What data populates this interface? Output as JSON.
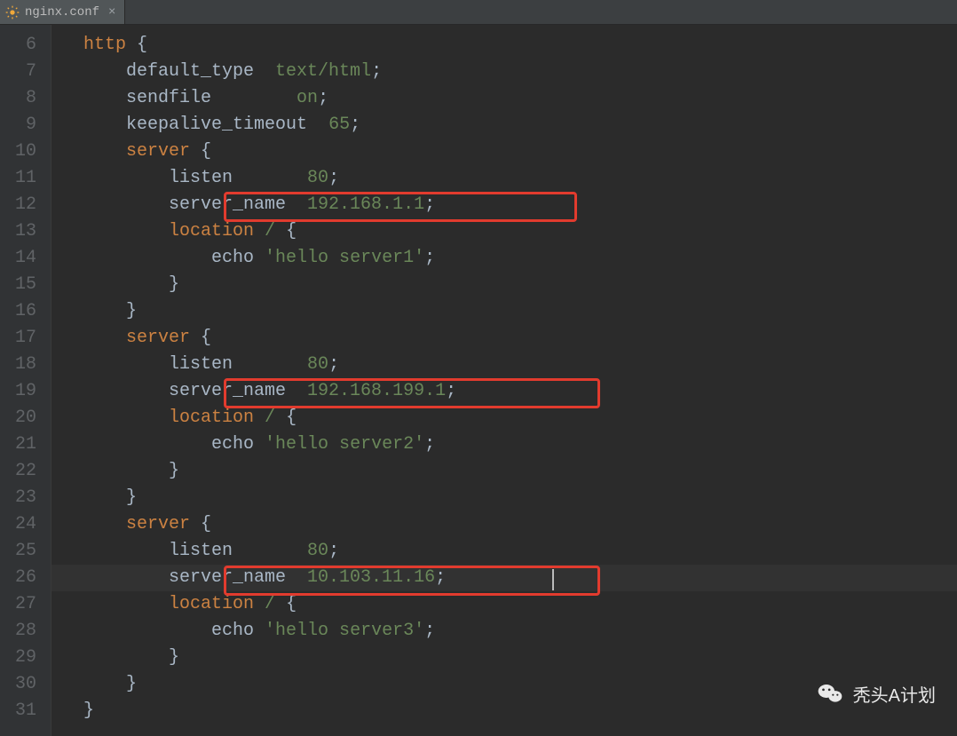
{
  "tab": {
    "filename": "nginx.conf",
    "close_glyph": "×"
  },
  "gutter": {
    "start": 6,
    "end": 31
  },
  "code": {
    "lines": [
      {
        "n": 6,
        "indent": 0,
        "tokens": [
          [
            "kw",
            "http"
          ],
          [
            "punc",
            " {"
          ]
        ]
      },
      {
        "n": 7,
        "indent": 1,
        "tokens": [
          [
            "dir",
            "default_type  "
          ],
          [
            "val",
            "text/html"
          ],
          [
            "punc",
            ";"
          ]
        ]
      },
      {
        "n": 8,
        "indent": 1,
        "tokens": [
          [
            "dir",
            "sendfile        "
          ],
          [
            "val",
            "on"
          ],
          [
            "punc",
            ";"
          ]
        ]
      },
      {
        "n": 9,
        "indent": 1,
        "tokens": [
          [
            "dir",
            "keepalive_timeout  "
          ],
          [
            "val",
            "65"
          ],
          [
            "punc",
            ";"
          ]
        ]
      },
      {
        "n": 10,
        "indent": 1,
        "tokens": [
          [
            "kw",
            "server"
          ],
          [
            "punc",
            " {"
          ]
        ]
      },
      {
        "n": 11,
        "indent": 2,
        "tokens": [
          [
            "dir",
            "listen       "
          ],
          [
            "val",
            "80"
          ],
          [
            "punc",
            ";"
          ]
        ]
      },
      {
        "n": 12,
        "indent": 2,
        "tokens": [
          [
            "dir",
            "server_name  "
          ],
          [
            "val",
            "192.168.1.1"
          ],
          [
            "punc",
            ";"
          ]
        ]
      },
      {
        "n": 13,
        "indent": 2,
        "tokens": [
          [
            "kw",
            "location"
          ],
          [
            "dir",
            " "
          ],
          [
            "val",
            "/"
          ],
          [
            "punc",
            " {"
          ]
        ]
      },
      {
        "n": 14,
        "indent": 3,
        "tokens": [
          [
            "dir",
            "echo "
          ],
          [
            "str",
            "'hello server1'"
          ],
          [
            "punc",
            ";"
          ]
        ]
      },
      {
        "n": 15,
        "indent": 2,
        "tokens": [
          [
            "punc",
            "}"
          ]
        ]
      },
      {
        "n": 16,
        "indent": 1,
        "tokens": [
          [
            "punc",
            "}"
          ]
        ]
      },
      {
        "n": 17,
        "indent": 1,
        "tokens": [
          [
            "kw",
            "server"
          ],
          [
            "punc",
            " {"
          ]
        ]
      },
      {
        "n": 18,
        "indent": 2,
        "tokens": [
          [
            "dir",
            "listen       "
          ],
          [
            "val",
            "80"
          ],
          [
            "punc",
            ";"
          ]
        ]
      },
      {
        "n": 19,
        "indent": 2,
        "tokens": [
          [
            "dir",
            "server_name  "
          ],
          [
            "val",
            "192.168.199.1"
          ],
          [
            "punc",
            ";"
          ]
        ]
      },
      {
        "n": 20,
        "indent": 2,
        "tokens": [
          [
            "kw",
            "location"
          ],
          [
            "dir",
            " "
          ],
          [
            "val",
            "/"
          ],
          [
            "punc",
            " {"
          ]
        ]
      },
      {
        "n": 21,
        "indent": 3,
        "tokens": [
          [
            "dir",
            "echo "
          ],
          [
            "str",
            "'hello server2'"
          ],
          [
            "punc",
            ";"
          ]
        ]
      },
      {
        "n": 22,
        "indent": 2,
        "tokens": [
          [
            "punc",
            "}"
          ]
        ]
      },
      {
        "n": 23,
        "indent": 1,
        "tokens": [
          [
            "punc",
            "}"
          ]
        ]
      },
      {
        "n": 24,
        "indent": 1,
        "tokens": [
          [
            "kw",
            "server"
          ],
          [
            "punc",
            " {"
          ]
        ]
      },
      {
        "n": 25,
        "indent": 2,
        "tokens": [
          [
            "dir",
            "listen       "
          ],
          [
            "val",
            "80"
          ],
          [
            "punc",
            ";"
          ]
        ]
      },
      {
        "n": 26,
        "indent": 2,
        "tokens": [
          [
            "dir",
            "server_name  "
          ],
          [
            "val",
            "10.103.11.16"
          ],
          [
            "punc",
            ";"
          ]
        ],
        "current": true
      },
      {
        "n": 27,
        "indent": 2,
        "tokens": [
          [
            "kw",
            "location"
          ],
          [
            "dir",
            " "
          ],
          [
            "val",
            "/"
          ],
          [
            "punc",
            " {"
          ]
        ]
      },
      {
        "n": 28,
        "indent": 3,
        "tokens": [
          [
            "dir",
            "echo "
          ],
          [
            "str",
            "'hello server3'"
          ],
          [
            "punc",
            ";"
          ]
        ]
      },
      {
        "n": 29,
        "indent": 2,
        "tokens": [
          [
            "punc",
            "}"
          ]
        ]
      },
      {
        "n": 30,
        "indent": 1,
        "tokens": [
          [
            "punc",
            "}"
          ]
        ]
      },
      {
        "n": 31,
        "indent": 0,
        "tokens": [
          [
            "punc",
            "}"
          ]
        ]
      }
    ],
    "indent_unit": "    "
  },
  "highlights": {
    "boxes": [
      {
        "line": 12
      },
      {
        "line": 19
      },
      {
        "line": 26
      }
    ],
    "current_line": 26
  },
  "watermark": {
    "text": "秃头A计划"
  }
}
